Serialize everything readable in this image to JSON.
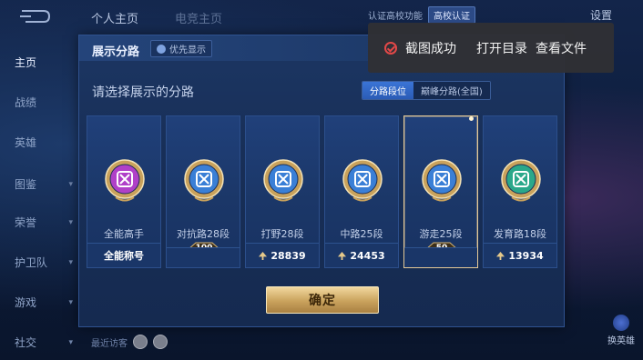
{
  "nav": {
    "items": [
      {
        "label": "主页",
        "has_chevron": false,
        "active": true
      },
      {
        "label": "战绩",
        "has_chevron": false,
        "active": false
      },
      {
        "label": "英雄",
        "has_chevron": false,
        "active": false
      },
      {
        "label": "图鉴",
        "has_chevron": true,
        "active": false
      },
      {
        "label": "荣誉",
        "has_chevron": true,
        "active": false
      },
      {
        "label": "护卫队",
        "has_chevron": true,
        "active": false
      },
      {
        "label": "游戏",
        "has_chevron": true,
        "active": false
      },
      {
        "label": "社交",
        "has_chevron": true,
        "active": false
      }
    ]
  },
  "header": {
    "tab_personal": "个人主页",
    "tab_second": "电竞主页",
    "cert_text": "认证高校功能",
    "cert_badge": "高校认证",
    "settings": "设置"
  },
  "dialog": {
    "title": "展示分路",
    "pref_button": "优先显示",
    "prompt": "请选择展示的分路",
    "segments": [
      {
        "label": "分路段位",
        "selected": true
      },
      {
        "label": "巅峰分路(全国)",
        "selected": false
      }
    ],
    "cards": [
      {
        "name": "全能高手",
        "footer": "全能称号",
        "footer_type": "title",
        "emblem_color": "#b040c8",
        "selected": false
      },
      {
        "name": "对抗路28段",
        "footer": "100",
        "footer_type": "medal",
        "emblem_color": "#3a7fd6",
        "selected": false
      },
      {
        "name": "打野28段",
        "footer": "28839",
        "footer_type": "score",
        "emblem_color": "#3a7fd6",
        "selected": false
      },
      {
        "name": "中路25段",
        "footer": "24453",
        "footer_type": "score",
        "emblem_color": "#3a7fd6",
        "selected": false
      },
      {
        "name": "游走25段",
        "footer": "50",
        "footer_type": "medal",
        "emblem_color": "#3a7fd6",
        "selected": true
      },
      {
        "name": "发育路18段",
        "footer": "13934",
        "footer_type": "score",
        "emblem_color": "#2aa88a",
        "selected": false
      }
    ],
    "confirm": "确定"
  },
  "toast": {
    "message": "截图成功",
    "action_open": "打开目录",
    "action_view": "查看文件"
  },
  "bottom": {
    "visitors": "最近访客",
    "right_button": "换英雄"
  },
  "colors": {
    "accent_blue": "#2b5cb6",
    "gold": "#c9a25c",
    "selected_border": "#e4c997"
  }
}
